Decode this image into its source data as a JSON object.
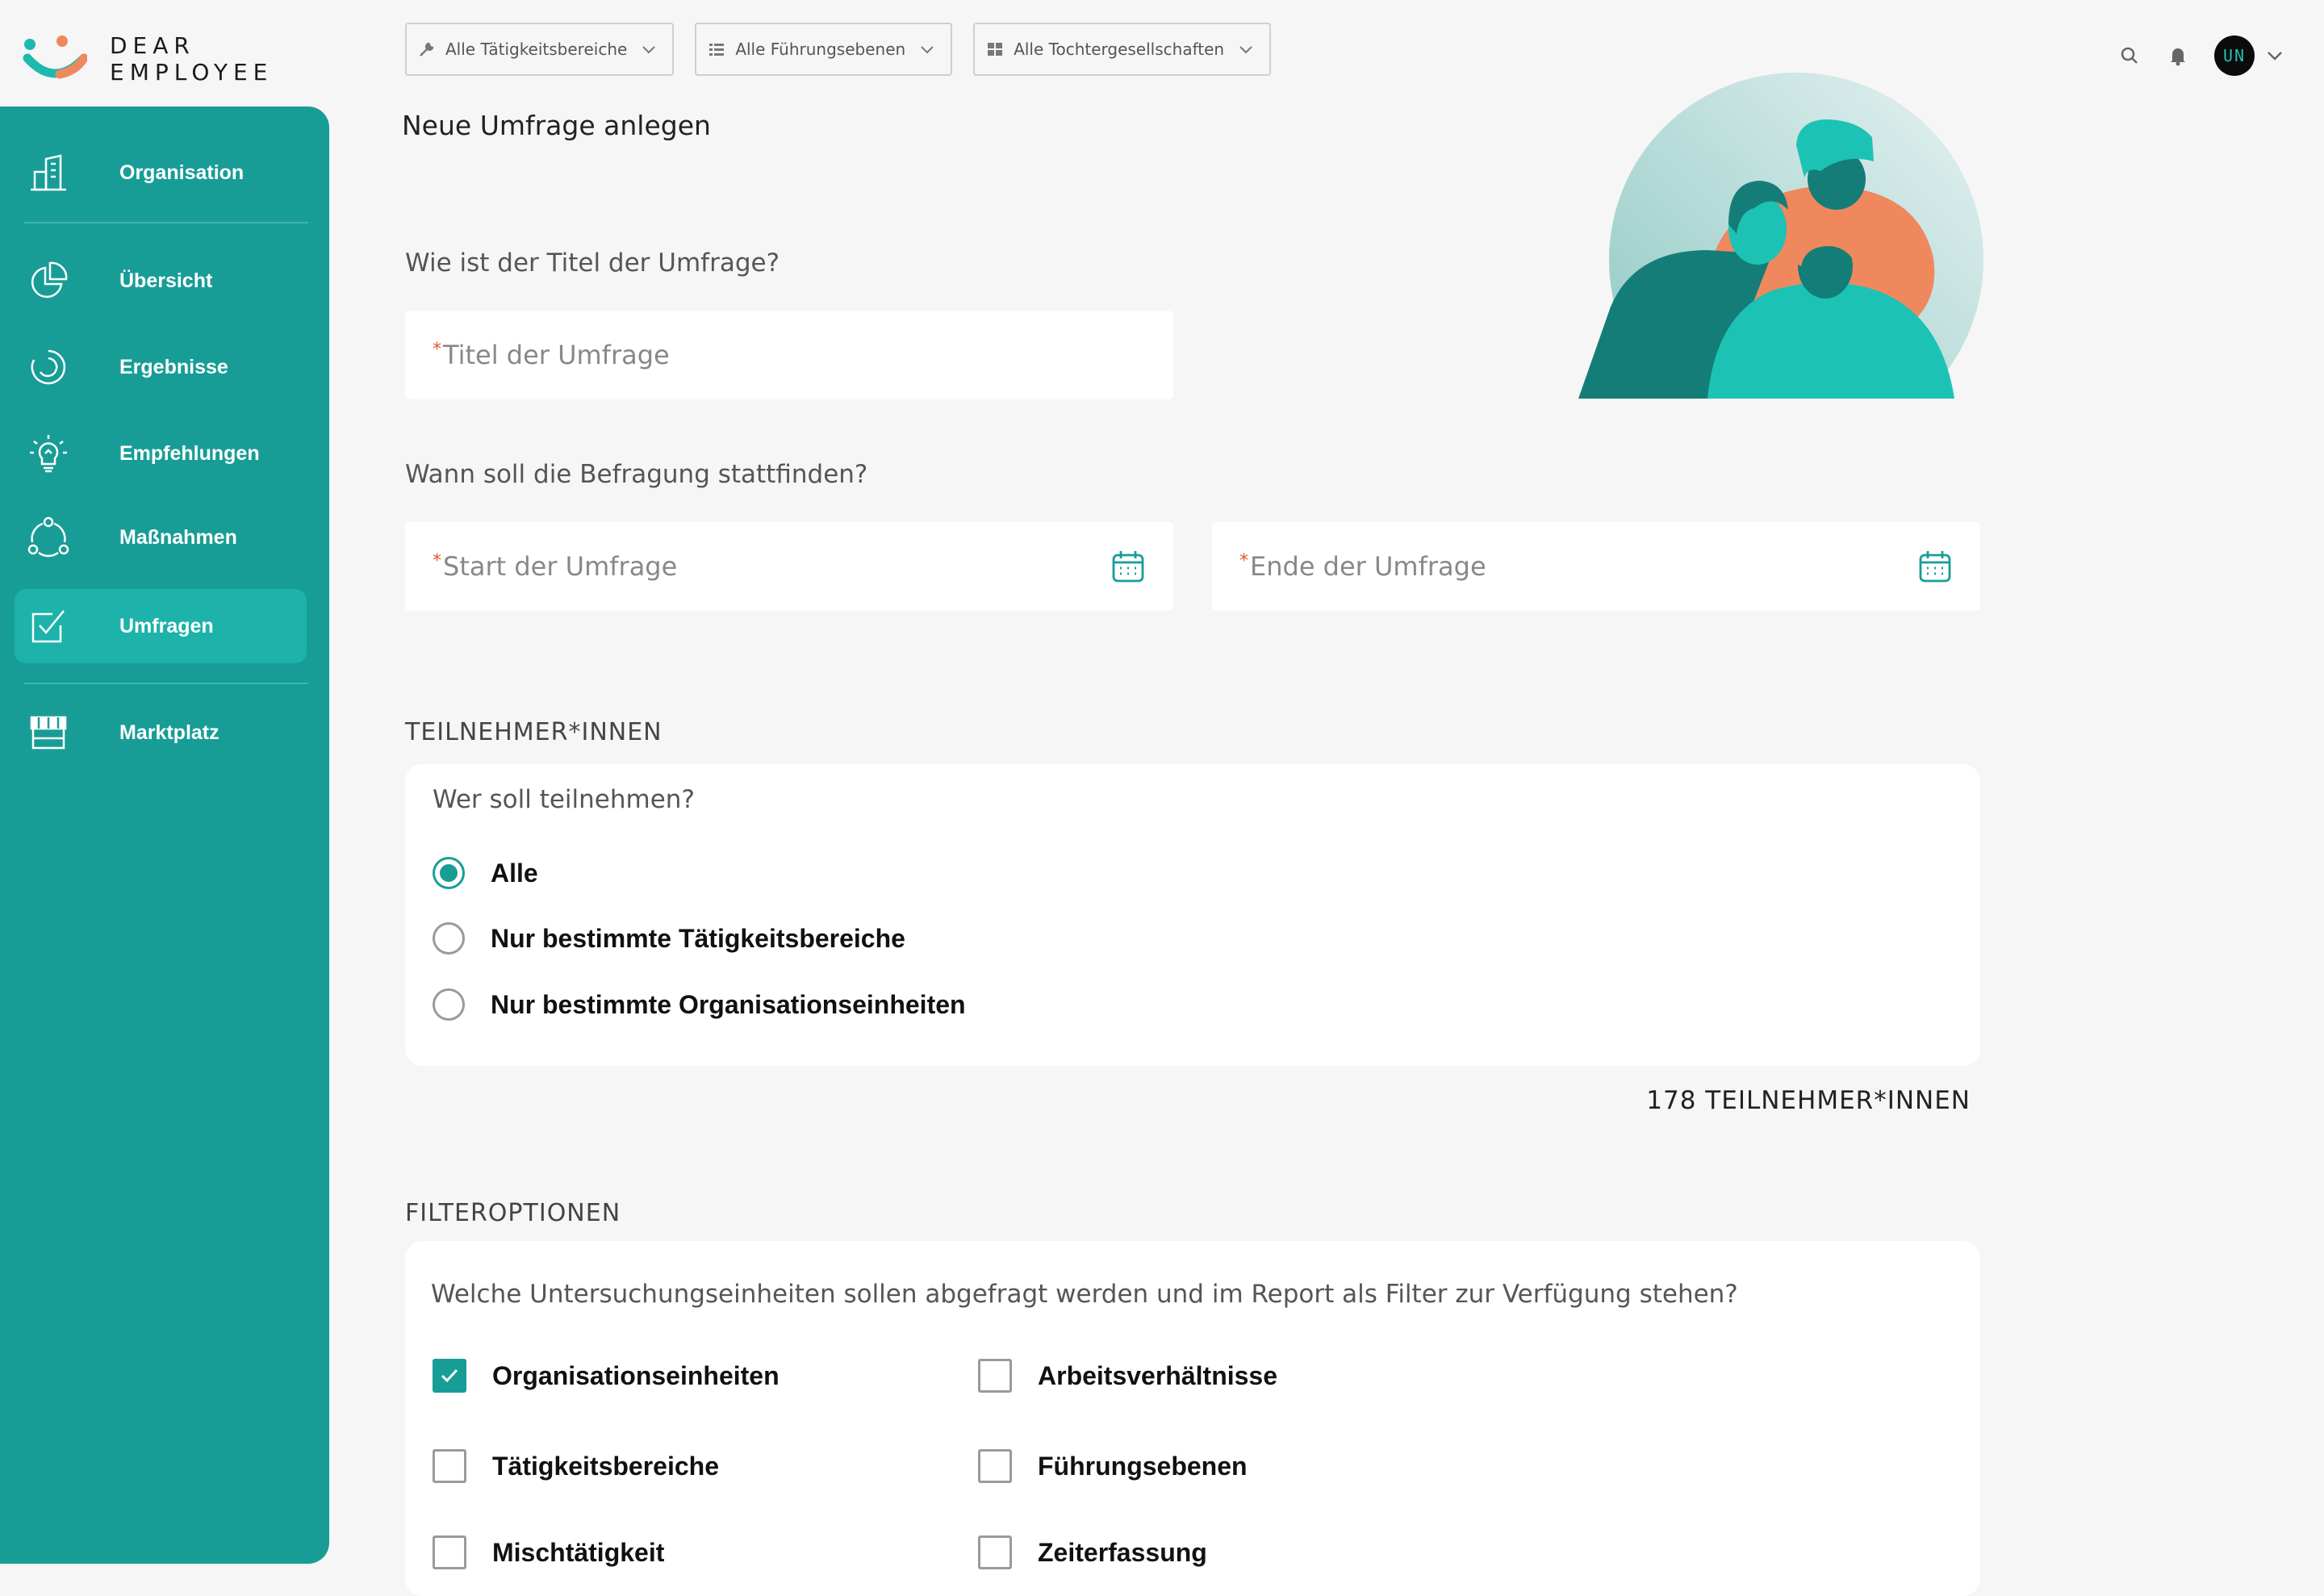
{
  "logo": {
    "line1": "DEAR",
    "line2": "EMPLOYEE"
  },
  "filters": [
    {
      "label": "Alle Tätigkeitsbereiche",
      "icon": "wrench-icon"
    },
    {
      "label": "Alle Führungsebenen",
      "icon": "list-icon"
    },
    {
      "label": "Alle Tochtergesellschaften",
      "icon": "grid-icon"
    }
  ],
  "user": {
    "initials": "UN"
  },
  "sidebar": {
    "items": [
      {
        "label": "Organisation",
        "icon": "building-icon"
      },
      {
        "label": "Übersicht",
        "icon": "pie-chart-icon"
      },
      {
        "label": "Ergebnisse",
        "icon": "progress-circle-icon"
      },
      {
        "label": "Empfehlungen",
        "icon": "lightbulb-icon"
      },
      {
        "label": "Maßnahmen",
        "icon": "cycle-icon"
      },
      {
        "label": "Umfragen",
        "icon": "checkbox-icon",
        "active": true
      },
      {
        "label": "Marktplatz",
        "icon": "store-icon"
      }
    ]
  },
  "main": {
    "page_title": "Neue Umfrage anlegen",
    "title_question": "Wie ist der Titel der Umfrage?",
    "title_placeholder": "Titel der Umfrage",
    "date_question": "Wann soll die Befragung stattfinden?",
    "start_placeholder": "Start der Umfrage",
    "end_placeholder": "Ende der Umfrage",
    "required_mark": "*",
    "participants": {
      "section": "TEILNEHMER*INNEN",
      "question": "Wer soll teilnehmen?",
      "options": [
        {
          "label": "Alle",
          "selected": true
        },
        {
          "label": "Nur bestimmte Tätigkeitsbereiche",
          "selected": false
        },
        {
          "label": "Nur bestimmte Organisationseinheiten",
          "selected": false
        }
      ],
      "count": "178 TEILNEHMER*INNEN"
    },
    "filter_options": {
      "section": "FILTEROPTIONEN",
      "question": "Welche Untersuchungseinheiten sollen abgefragt werden und im Report als Filter zur Verfügung stehen?",
      "items": [
        {
          "label": "Organisationseinheiten",
          "checked": true
        },
        {
          "label": "Arbeitsverhältnisse",
          "checked": false
        },
        {
          "label": "Tätigkeitsbereiche",
          "checked": false
        },
        {
          "label": "Führungsebenen",
          "checked": false
        },
        {
          "label": "Mischtätigkeit",
          "checked": false
        },
        {
          "label": "Zeiterfassung",
          "checked": false
        }
      ]
    }
  },
  "colors": {
    "accent": "#189d96",
    "accent_active": "#1db2aa",
    "required": "#e8542c",
    "illustration_orange": "#f0885e"
  }
}
